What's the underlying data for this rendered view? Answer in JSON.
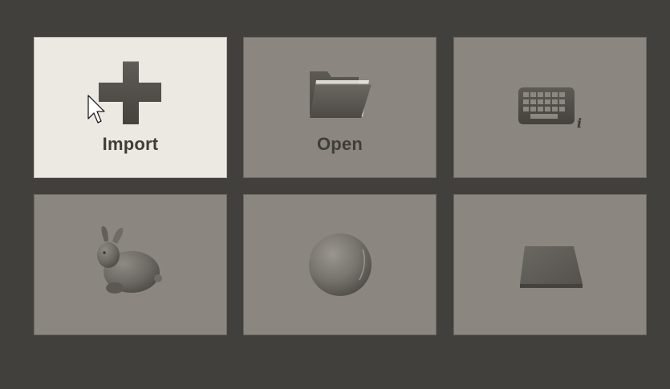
{
  "tiles": [
    {
      "label": "Import",
      "icon": "plus-icon",
      "state": "hovered"
    },
    {
      "label": "Open",
      "icon": "folder-icon"
    },
    {
      "label": "",
      "icon": "keyboard-info-icon"
    },
    {
      "label": "",
      "icon": "bunny-model-icon"
    },
    {
      "label": "",
      "icon": "sphere-icon"
    },
    {
      "label": "",
      "icon": "plane-icon"
    }
  ],
  "colors": {
    "background": "#42403c",
    "tile": "#8b8780",
    "tile_hover": "#ece9e3",
    "label": "#3f3d39"
  },
  "keyboard_info_glyph": "i"
}
